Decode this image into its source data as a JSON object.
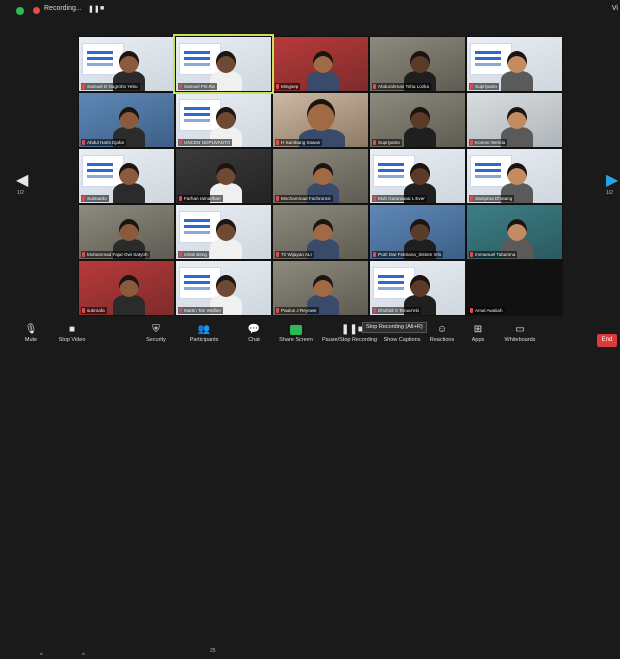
{
  "topbar": {
    "recording_label": "Recording...",
    "pause_symbol": "❚❚",
    "stop_symbol": "■",
    "view_label": "Vi"
  },
  "nav": {
    "prev_symbol": "◀",
    "next_symbol": "▶",
    "prev_page": "1/2",
    "next_page": "1/2"
  },
  "participants": [
    {
      "name": "Samuel D Nugroho Yebu",
      "scene": "slide",
      "muted": true
    },
    {
      "name": "Samuel Pst.Ra",
      "scene": "slide",
      "muted": true,
      "active": true
    },
    {
      "name": "Mingsep",
      "scene": "red",
      "muted": true
    },
    {
      "name": "Abdurahman Toha Lozka",
      "scene": "room",
      "muted": true
    },
    {
      "name": "Supriyanto",
      "scene": "slide",
      "muted": true
    },
    {
      "name": "Abdul Haris Djafar",
      "scene": "blue",
      "muted": true
    },
    {
      "name": "UNCEN NOPUVANTO",
      "scene": "slide",
      "muted": true
    },
    {
      "name": "H Sambang Irawan",
      "scene": "closeup",
      "muted": true
    },
    {
      "name": "Supriyanto",
      "scene": "room",
      "muted": true
    },
    {
      "name": "Komoo Werida",
      "scene": "light",
      "muted": true
    },
    {
      "name": "Sulmardo",
      "scene": "slide",
      "muted": true
    },
    {
      "name": "Farhan ramadhan",
      "scene": "dark",
      "muted": true
    },
    {
      "name": "Mochammad Fachrorosi",
      "scene": "room",
      "muted": true
    },
    {
      "name": "Muh Garanawai L Ever",
      "scene": "slide",
      "muted": true
    },
    {
      "name": "Samproa Dhotang",
      "scene": "slide",
      "muted": true
    },
    {
      "name": "Muhammad Fajar Dwi Satyoh",
      "scene": "room",
      "muted": true
    },
    {
      "name": "Ishak Beng",
      "scene": "slide",
      "muted": true
    },
    {
      "name": "Tri Wijayao ALI",
      "scene": "room",
      "muted": true
    },
    {
      "name": "Putri Dwi Febriana_Sistem Info",
      "scene": "blue",
      "muted": true
    },
    {
      "name": "Immanuel Tabarima",
      "scene": "teal",
      "muted": true
    },
    {
      "name": "sukroafa",
      "scene": "red",
      "muted": true
    },
    {
      "name": "Martin Tan Welber",
      "scene": "slide",
      "muted": true
    },
    {
      "name": "Paulus J Reyowe",
      "scene": "room",
      "muted": true
    },
    {
      "name": "Dhohidi S Teruar'eki",
      "scene": "slide",
      "muted": true
    },
    {
      "name": "Amal Awaliah",
      "scene": "empty",
      "muted": true
    }
  ],
  "toolbar": {
    "mute": "Mute",
    "stop_video": "Stop Video",
    "security": "Security",
    "participants": "Participants",
    "participants_count": "25",
    "chat": "Chat",
    "share_screen": "Share Screen",
    "record": "Pause/Stop Recording",
    "captions": "Show Captions",
    "reactions": "Reactions",
    "apps": "Apps",
    "whiteboards": "Whiteboards",
    "end": "End",
    "tooltip": "Stop Recording (Alt+R)"
  },
  "icons": {
    "mic": "mic-icon",
    "camera": "camera-icon",
    "shield": "shield-icon",
    "people": "people-icon",
    "chat": "chat-icon",
    "share": "share-screen-icon",
    "record": "record-icon",
    "cc": "captions-icon",
    "smile": "reactions-icon",
    "apps": "apps-icon",
    "board": "whiteboard-icon"
  },
  "colors": {
    "active_speaker": "#c9e05a",
    "end_button": "#d93a3a",
    "share_green": "#2dbb55",
    "muted_red": "#e34c4c",
    "nav_blue": "#2aa0e6"
  }
}
